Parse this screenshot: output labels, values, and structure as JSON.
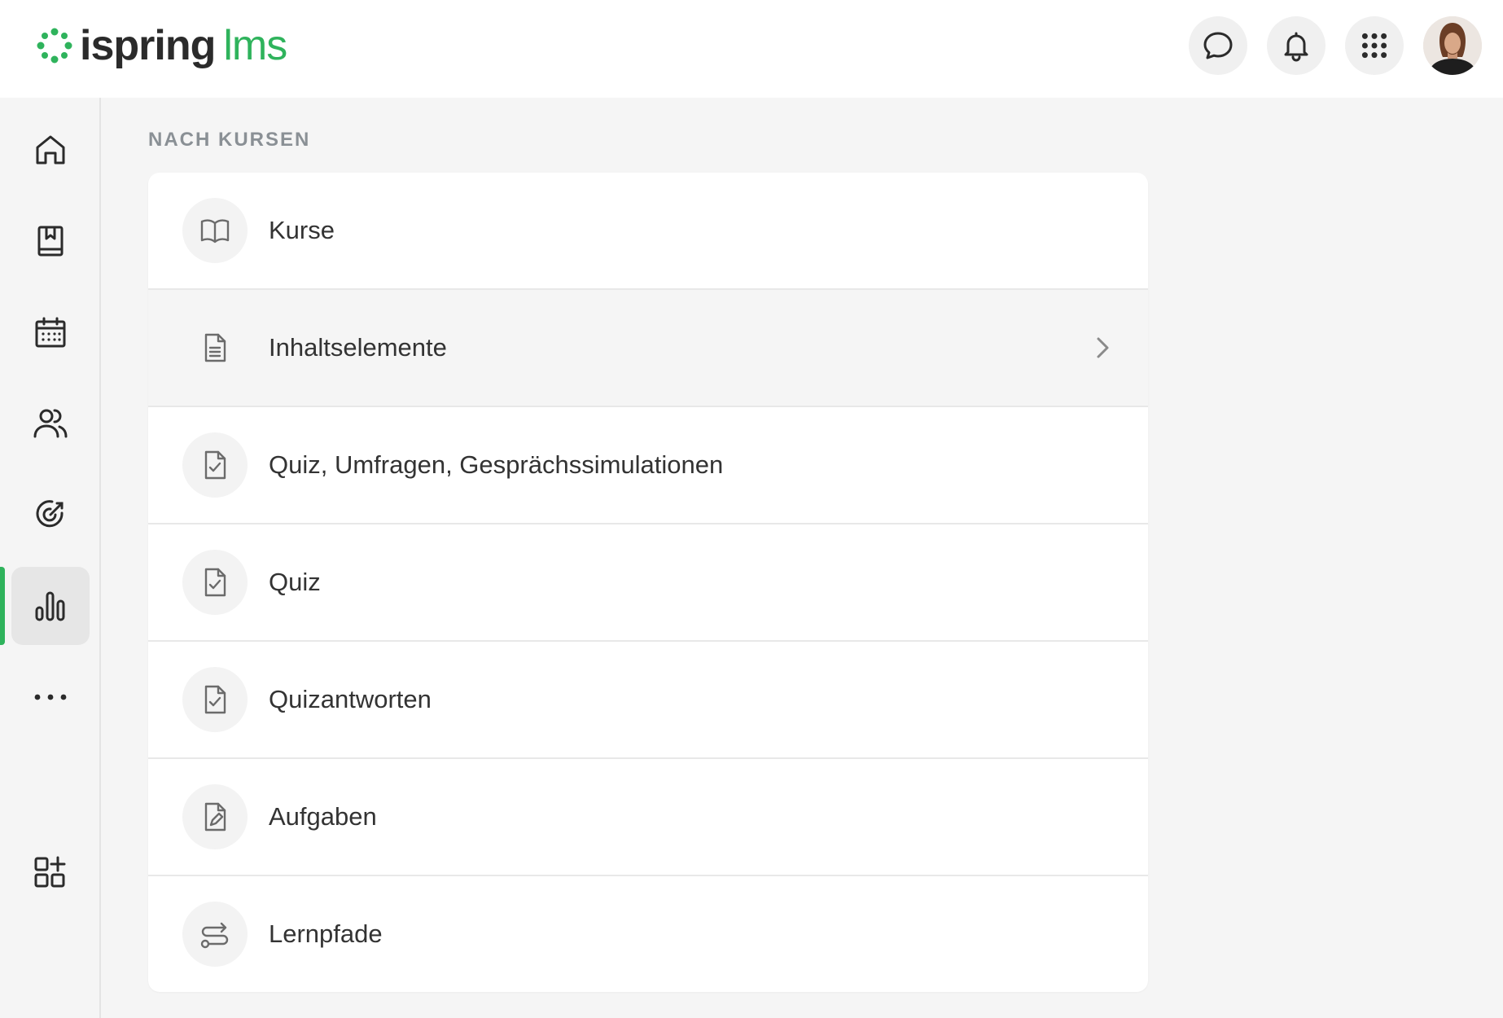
{
  "brand": {
    "name": "ispring",
    "product": "lms",
    "colors": {
      "accent": "#2fb35c",
      "text": "#2b2b2b"
    }
  },
  "header": {
    "buttons": [
      {
        "icon": "chat-bubble-icon"
      },
      {
        "icon": "bell-icon"
      },
      {
        "icon": "apps-grid-icon"
      }
    ],
    "avatar_icon": "user-avatar"
  },
  "sidebar": {
    "items": [
      {
        "icon": "home-icon",
        "active": false
      },
      {
        "icon": "bookmark-book-icon",
        "active": false
      },
      {
        "icon": "calendar-icon",
        "active": false
      },
      {
        "icon": "users-icon",
        "active": false
      },
      {
        "icon": "target-icon",
        "active": false
      },
      {
        "icon": "bar-chart-icon",
        "active": true
      },
      {
        "icon": "more-dots-icon",
        "active": false
      }
    ],
    "bottom_item": {
      "icon": "add-widget-icon"
    }
  },
  "main": {
    "section_title": "NACH KURSEN",
    "rows": [
      {
        "label": "Kurse",
        "icon": "open-book-icon"
      },
      {
        "label": "Inhaltselemente",
        "icon": "document-icon",
        "highlighted": true,
        "chevron": "chevron-right-icon"
      },
      {
        "label": "Quiz, Umfragen, Gesprächssimulationen",
        "icon": "checklist-icon"
      },
      {
        "label": "Quiz",
        "icon": "checklist-icon"
      },
      {
        "label": "Quizantworten",
        "icon": "checklist-icon"
      },
      {
        "label": "Aufgaben",
        "icon": "edit-document-icon"
      },
      {
        "label": "Lernpfade",
        "icon": "path-icon"
      }
    ]
  }
}
